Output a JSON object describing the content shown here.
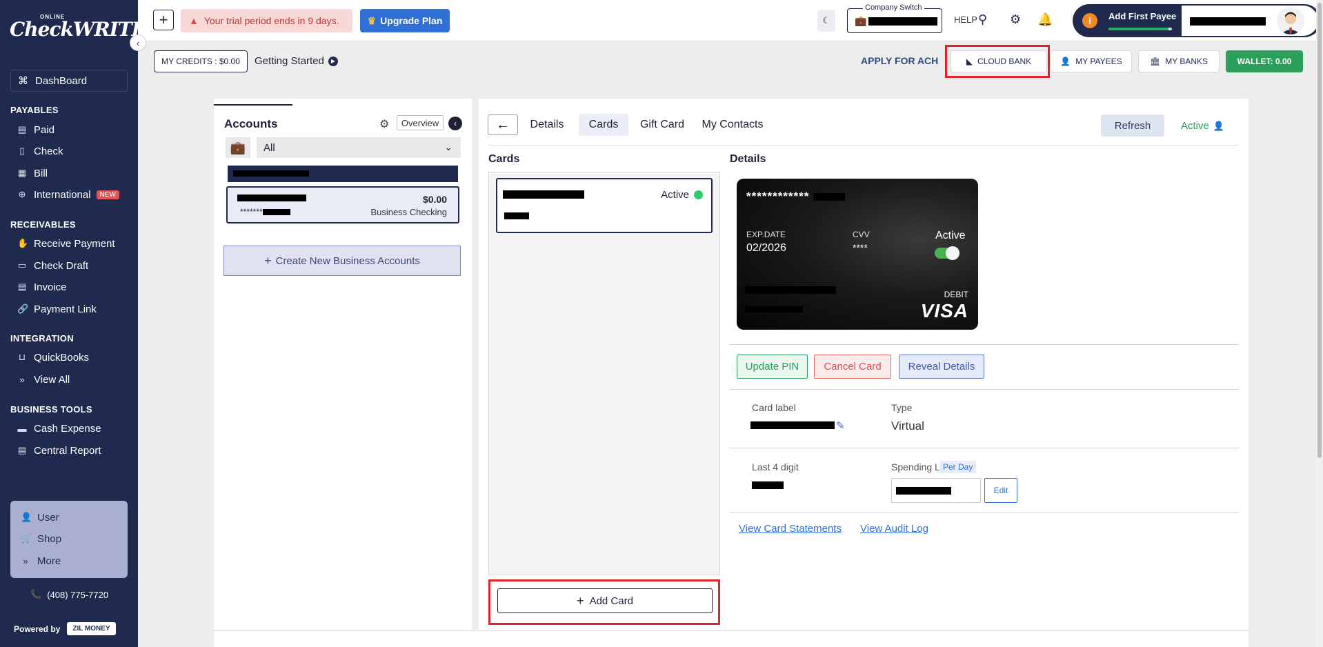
{
  "sidebar": {
    "logo_small": "ONLINE",
    "logo": "CheckWRITER",
    "dashboard": "DashBoard",
    "sections": {
      "payables": "PAYABLES",
      "receivables": "RECEIVABLES",
      "integration": "INTEGRATION",
      "business_tools": "BUSINESS TOOLS"
    },
    "payables": [
      "Paid",
      "Check",
      "Bill",
      "International"
    ],
    "new_badge": "NEW",
    "receivables": [
      "Receive Payment",
      "Check Draft",
      "Invoice",
      "Payment Link"
    ],
    "integration": [
      "QuickBooks",
      "View All"
    ],
    "business_tools": [
      "Cash Expense",
      "Central Report"
    ],
    "bottom": [
      "User",
      "Shop",
      "More"
    ],
    "phone": "(408) 775-7720",
    "powered_by": "Powered by",
    "zil": "ZIL MONEY"
  },
  "topbar": {
    "trial": "Your trial period ends in 9 days.",
    "upgrade": "Upgrade Plan",
    "company_switch": "Company Switch",
    "help": "HELP",
    "add_payee": "Add First Payee",
    "payee_progress": 0.95
  },
  "subbar": {
    "credits": "MY CREDITS : $0.00",
    "getting_started": "Getting Started",
    "apply_ach": "APPLY FOR ACH",
    "cloud_bank": "CLOUD BANK",
    "my_payees": "MY PAYEES",
    "my_banks": "MY BANKS",
    "wallet": "WALLET: 0.00"
  },
  "accounts": {
    "title": "Accounts",
    "overview": "Overview",
    "filter": "All",
    "stars": "*******",
    "balance": "$0.00",
    "account_type": "Business Checking",
    "create": "Create New Business Accounts"
  },
  "main": {
    "tabs": [
      "Details",
      "Cards",
      "Gift Card",
      "My Contacts"
    ],
    "refresh": "Refresh",
    "status": "Active",
    "cards_title": "Cards",
    "card_status": "Active",
    "add_card": "Add Card",
    "details_title": "Details",
    "card": {
      "number": "************",
      "exp_label": "EXP.DATE",
      "exp": "02/2026",
      "cvv_label": "CVV",
      "cvv": "****",
      "status": "Active",
      "debit": "DEBIT",
      "network": "VISA"
    },
    "buttons": {
      "update_pin": "Update PIN",
      "cancel_card": "Cancel Card",
      "reveal": "Reveal Details",
      "edit": "Edit"
    },
    "fields": {
      "card_label": "Card label",
      "type_label": "Type",
      "type": "Virtual",
      "last4_label": "Last 4 digit",
      "limit_label": "Spending Limit",
      "per_day": "Per Day"
    },
    "links": {
      "statements": "View Card Statements",
      "audit": "View Audit Log"
    }
  },
  "colors": {
    "sidebar": "#1f2a4e",
    "accent_green": "#2aa05a",
    "accent_blue": "#2f6fd6",
    "highlight_red": "#e2232b"
  }
}
